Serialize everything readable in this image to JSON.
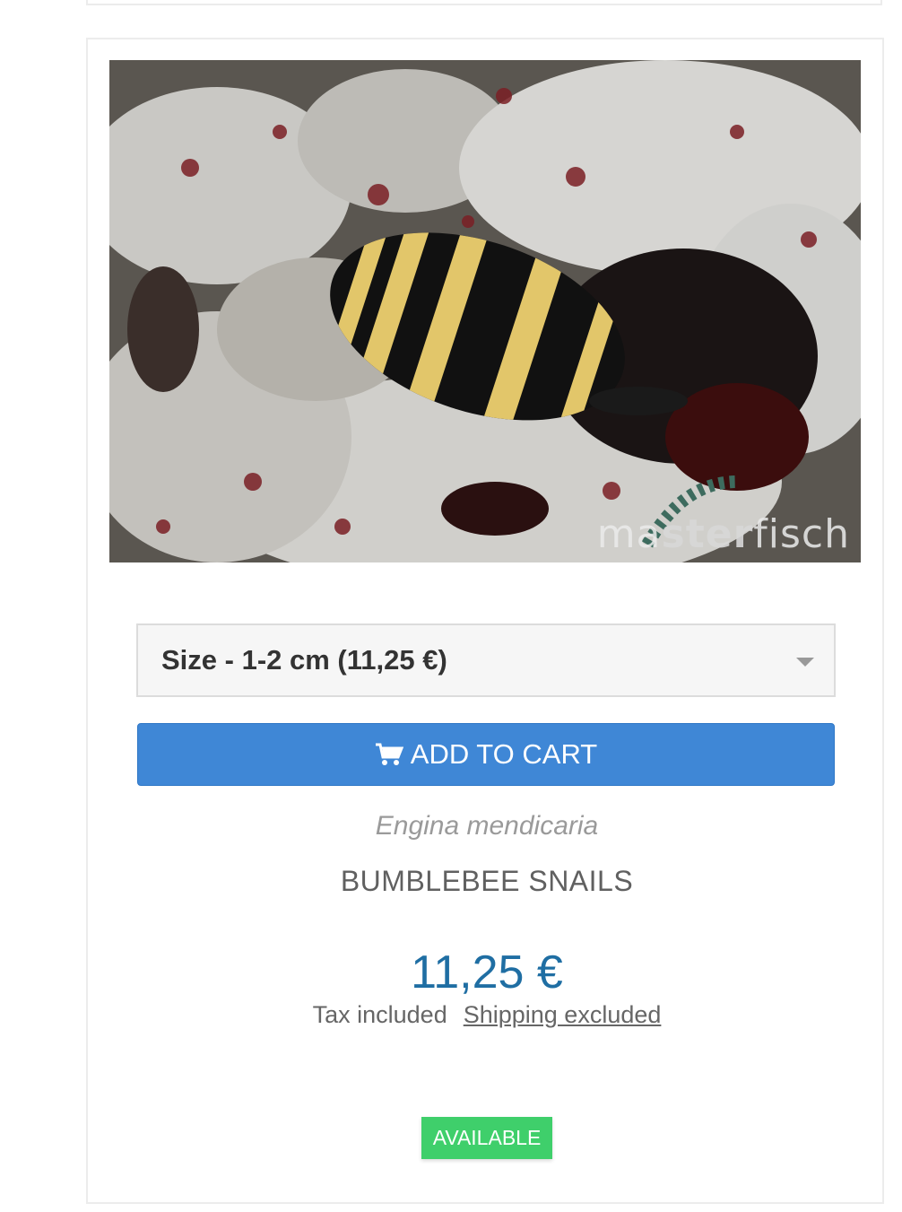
{
  "product": {
    "image_alt": "Bumblebee snail on live rock",
    "watermark_light": "ma",
    "watermark_bold": "ster",
    "watermark_tail": "fisch",
    "variant_select": {
      "selected": "Size - 1-2 cm (11,25 €)"
    },
    "add_to_cart_label": "ADD TO CART",
    "scientific_name": "Engina mendicaria",
    "common_name": "BUMBLEBEE SNAILS",
    "price": "11,25 €",
    "tax_label": "Tax included",
    "shipping_label": "Shipping excluded",
    "availability": "AVAILABLE"
  },
  "colors": {
    "accent": "#3f87d6",
    "price": "#1f6ea3",
    "available": "#3fcf6b"
  },
  "icons": {
    "cart": "cart-icon",
    "caret": "chevron-down-icon"
  }
}
